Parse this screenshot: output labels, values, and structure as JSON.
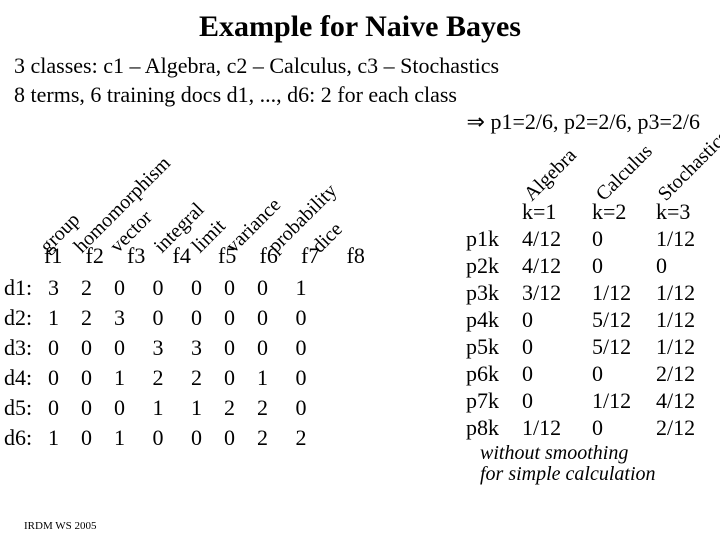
{
  "title": "Example for Naive Bayes",
  "intro_line1": "3 classes: c1 – Algebra, c2 – Calculus, c3 – Stochastics",
  "intro_line2": "8 terms, 6 training docs d1, ..., d6: 2 for each class",
  "prior_line": "p1=2/6, p2=2/6, p3=2/6",
  "arrow": "⇒",
  "terms": [
    "group",
    "homomorphism",
    "vector",
    "integral",
    "limit",
    "variance",
    "probability",
    "dice"
  ],
  "f_labels": [
    "f1",
    "f2",
    "f3",
    "f4",
    "f5",
    "f6",
    "f7",
    "f8"
  ],
  "doc_labels": [
    "d1:",
    "d2:",
    "d3:",
    "d4:",
    "d5:",
    "d6:"
  ],
  "freq": [
    [
      3,
      2,
      0,
      0,
      0,
      0,
      0,
      1
    ],
    [
      1,
      2,
      3,
      0,
      0,
      0,
      0,
      0
    ],
    [
      0,
      0,
      0,
      3,
      3,
      0,
      0,
      0
    ],
    [
      0,
      0,
      1,
      2,
      2,
      0,
      1,
      0
    ],
    [
      0,
      0,
      0,
      1,
      1,
      2,
      2,
      0
    ],
    [
      1,
      0,
      1,
      0,
      0,
      0,
      2,
      2
    ]
  ],
  "class_labels": [
    "Algebra",
    "Calculus",
    "Stochastics"
  ],
  "k_labels": [
    "k=1",
    "k=2",
    "k=3"
  ],
  "p_labels": [
    "p1k",
    "p2k",
    "p3k",
    "p4k",
    "p5k",
    "p6k",
    "p7k",
    "p8k"
  ],
  "p_values": [
    [
      "4/12",
      "0",
      "1/12"
    ],
    [
      "4/12",
      "0",
      "0"
    ],
    [
      "3/12",
      "1/12",
      "1/12"
    ],
    [
      "0",
      "5/12",
      "1/12"
    ],
    [
      "0",
      "5/12",
      "1/12"
    ],
    [
      "0",
      "0",
      "2/12"
    ],
    [
      "0",
      "1/12",
      "4/12"
    ],
    [
      "1/12",
      "0",
      "2/12"
    ]
  ],
  "note_line1": "without smoothing",
  "note_line2": "for simple calculation",
  "footer": "IRDM  WS 2005"
}
